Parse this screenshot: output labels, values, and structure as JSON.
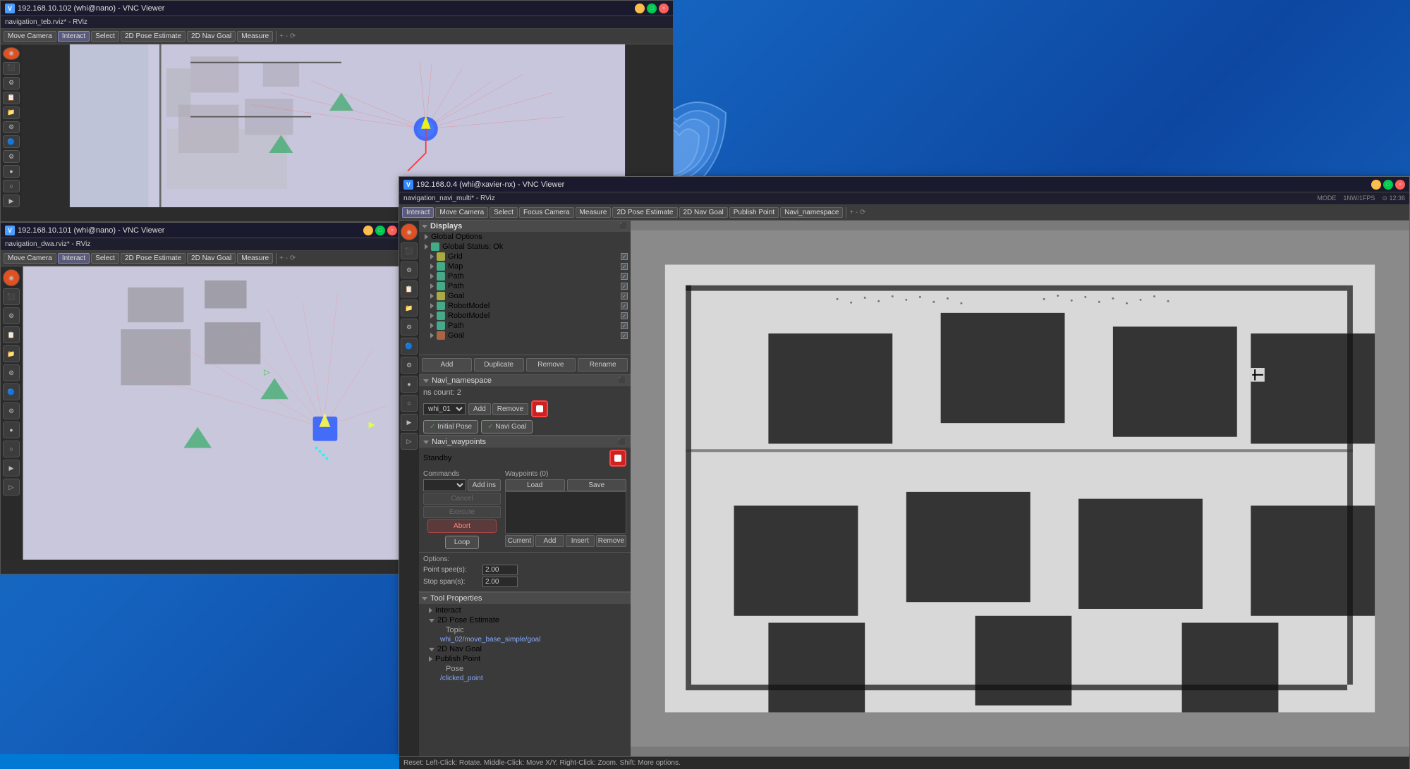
{
  "desktop": {
    "background_color": "#0078d4"
  },
  "vnc_windows": [
    {
      "id": "vnc1",
      "title": "192.168.10.102 (whi@nano) - VNC Viewer",
      "icon": "VB",
      "rviz_title": "navigation_teb.rviz* - RViz"
    },
    {
      "id": "vnc2",
      "title": "192.168.10.101 (whi@nano) - VNC Viewer",
      "icon": "VB",
      "rviz_title": "navigation_dwa.rviz* - RViz"
    },
    {
      "id": "vnc3",
      "title": "192.168.0.4 (whi@xavier-nx) - VNC Viewer",
      "icon": "VB",
      "rviz_title": "navigation_navi_multi* - RViz"
    }
  ],
  "toolbar": {
    "move_camera": "Move Camera",
    "interact": "Interact",
    "select": "Select",
    "pose_estimate": "2D Pose Estimate",
    "nav_goal": "2D Nav Goal",
    "measure": "Measure",
    "publish_point": "Publish Point",
    "navi_namespace": "Navi_namespace"
  },
  "displays": {
    "title": "Displays",
    "global_options": "Global Options",
    "global_status": "Global Status: Ok",
    "items": [
      {
        "name": "Grid",
        "checked": true,
        "icon": "yellow",
        "indent": 1
      },
      {
        "name": "Map",
        "checked": true,
        "icon": "green",
        "indent": 1
      },
      {
        "name": "Path",
        "checked": true,
        "icon": "green",
        "indent": 1
      },
      {
        "name": "Path",
        "checked": true,
        "icon": "green",
        "indent": 1
      },
      {
        "name": "Goal",
        "checked": true,
        "icon": "yellow",
        "indent": 1
      },
      {
        "name": "RobotModel",
        "checked": true,
        "icon": "green",
        "indent": 1
      },
      {
        "name": "RobotModel",
        "checked": true,
        "icon": "green",
        "indent": 1
      },
      {
        "name": "Path",
        "checked": true,
        "icon": "green",
        "indent": 1
      },
      {
        "name": "Goal",
        "checked": true,
        "icon": "orange",
        "indent": 1
      }
    ]
  },
  "action_buttons": {
    "add": "Add",
    "duplicate": "Duplicate",
    "remove": "Remove",
    "rename": "Rename"
  },
  "navi_namespace": {
    "title": "Navi_namespace",
    "ns_count": "ns count: 2",
    "current_ns": "whi_01",
    "add_btn": "Add",
    "remove_btn": "Remove",
    "initial_pose_btn": "Initial Pose",
    "navi_goal_btn": "Navi Goal"
  },
  "navi_waypoints": {
    "title": "Navi_waypoints",
    "standby": "Standby",
    "commands_label": "Commands",
    "waypoints_label": "Waypoints (0)",
    "load_btn": "Load",
    "save_btn": "Save",
    "cancel_btn": "Cancel",
    "execute_btn": "Execute",
    "abort_btn": "Abort",
    "loop_btn": "Loop"
  },
  "wp_controls": {
    "current": "Current",
    "add": "Add",
    "insert": "Insert",
    "remove": "Remove"
  },
  "options": {
    "title": "Options:",
    "point_speed_label": "Point spee(s):",
    "point_speed_value": "2.00",
    "stop_span_label": "Stop span(s):",
    "stop_span_value": "2.00"
  },
  "tool_properties": {
    "title": "Tool Properties",
    "interact": "Interact",
    "pose_estimate": "2D Pose Estimate",
    "topic_label": "Topic",
    "topic_value": "whi_02/move_base_simple/goal",
    "nav_goal": "2D Nav Goal",
    "pose_label": "Pose",
    "pose_value": "/clicked_point",
    "publish_point": "Publish Point"
  },
  "status_bar": {
    "text": "Reset: Left-Click: Rotate. Middle-Click: Move X/Y. Right-Click: Zoom. Shift: More options."
  }
}
